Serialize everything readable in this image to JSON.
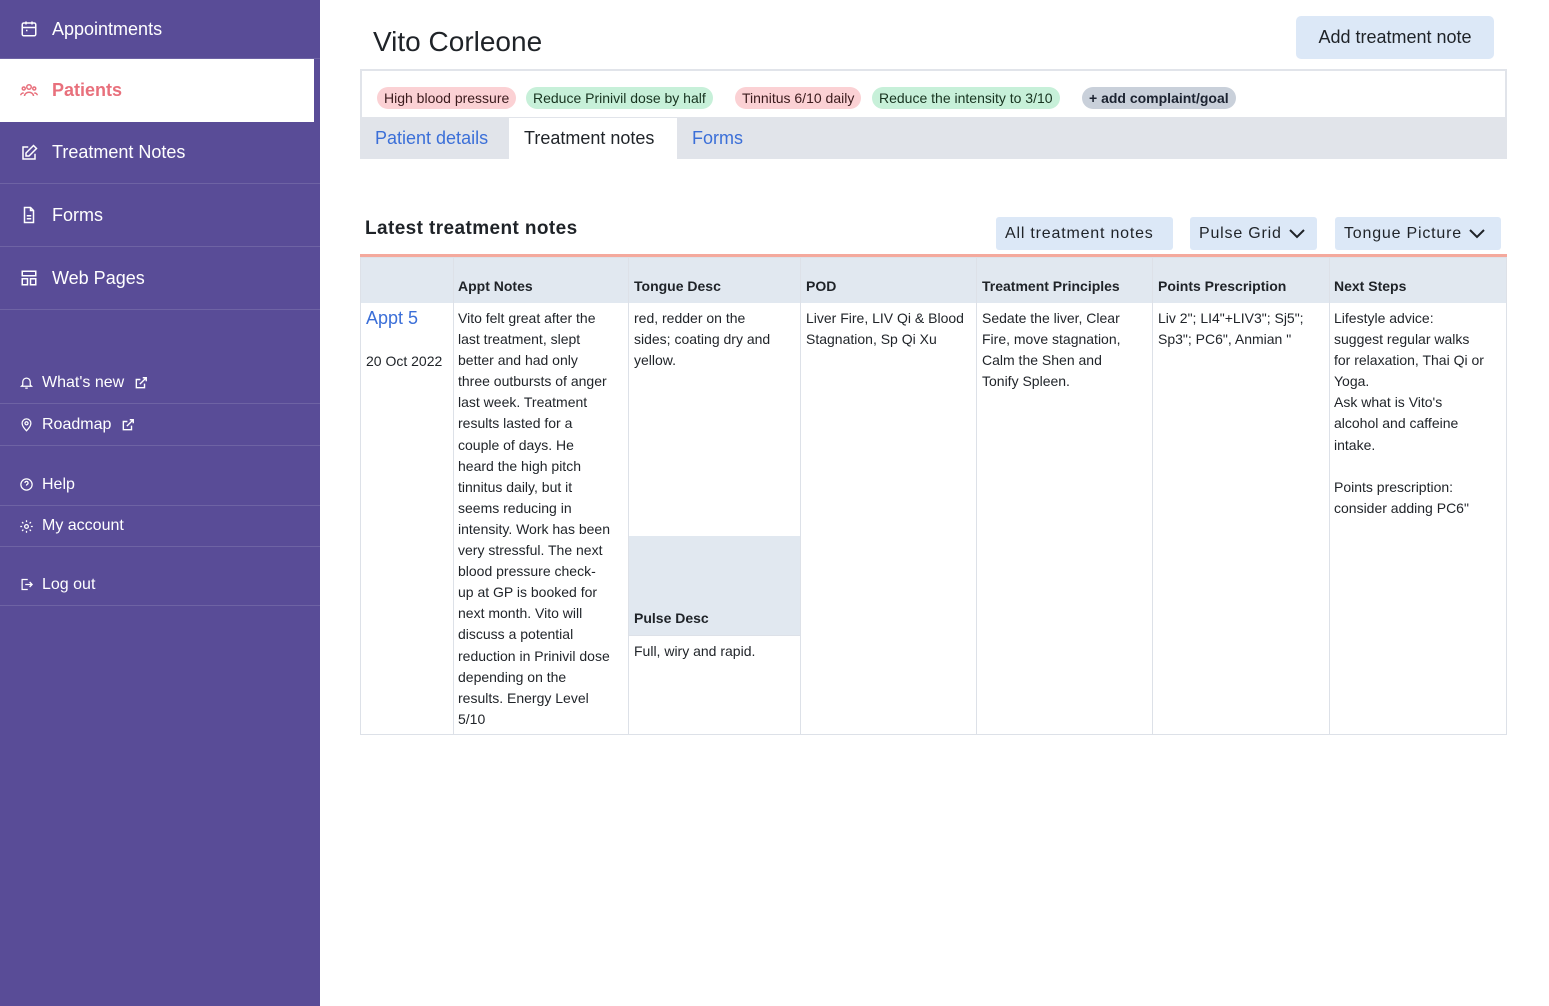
{
  "sidebar": {
    "items": [
      {
        "label": "Appointments",
        "icon": "calendar-icon"
      },
      {
        "label": "Patients",
        "icon": "users-icon"
      },
      {
        "label": "Treatment Notes",
        "icon": "edit-icon"
      },
      {
        "label": "Forms",
        "icon": "document-icon"
      },
      {
        "label": "Web Pages",
        "icon": "layout-icon"
      }
    ],
    "secondary": [
      {
        "label": "What's new",
        "icon": "bell-icon"
      },
      {
        "label": "Roadmap",
        "icon": "map-pin-icon"
      },
      {
        "label": "Help",
        "icon": "help-circle-icon"
      },
      {
        "label": "My account",
        "icon": "gear-icon"
      },
      {
        "label": "Log out",
        "icon": "logout-icon"
      }
    ],
    "colors": {
      "background": "#594c97",
      "active_text": "#e8707c"
    }
  },
  "header": {
    "patient_name": "Vito Corleone",
    "add_note_label": "Add treatment note"
  },
  "goals": {
    "pills": [
      {
        "label": "High blood pressure",
        "kind": "complaint"
      },
      {
        "label": "Reduce Prinivil dose by half",
        "kind": "goal"
      },
      {
        "label": "Tinnitus 6/10 daily",
        "kind": "complaint"
      },
      {
        "label": "Reduce the intensity to 3/10",
        "kind": "goal"
      }
    ],
    "add_label": "+ add complaint/goal"
  },
  "tabs": [
    {
      "label": "Patient details"
    },
    {
      "label": "Treatment notes",
      "active": true
    },
    {
      "label": "Forms"
    }
  ],
  "section": {
    "title": "Latest treatment notes",
    "filters": [
      {
        "label": "All treatment notes",
        "dropdown": false
      },
      {
        "label": "Pulse Grid",
        "dropdown": true
      },
      {
        "label": "Tongue Picture",
        "dropdown": true
      }
    ]
  },
  "table": {
    "columns": [
      "Appt Notes",
      "Tongue Desc",
      "POD",
      "Treatment Principles",
      "Points Prescription",
      "Next Steps"
    ],
    "pulse_header": "Pulse Desc",
    "rows": [
      {
        "appt": "Appt 5",
        "date": "20 Oct 2022",
        "appt_notes": "Vito felt great after the\nlast treatment, slept\nbetter and had only\nthree outbursts of anger\nlast week. Treatment\nresults lasted for a\ncouple of days. He\nheard the high pitch\ntinnitus daily, but it\nseems reducing in\nintensity. Work has been\nvery stressful. The next\nblood pressure check-\nup at GP is booked for\nnext month. Vito will\ndiscuss a potential\nreduction in Prinivil dose\ndepending on the\nresults. Energy Level\n5/10",
        "tongue_desc": "red, redder on the\nsides; coating dry and\nyellow.",
        "pulse_desc": "Full, wiry and rapid.",
        "pod": "Liver Fire, LIV Qi & Blood\nStagnation, Sp Qi Xu",
        "treatment_principles": "Sedate the liver, Clear\nFire, move stagnation,\nCalm the Shen and\nTonify Spleen.",
        "points_prescription": "Liv 2\"; LI4\"+LIV3\"; Sj5\";\nSp3\"; PC6\", Anmian \"",
        "next_steps": "Lifestyle advice:\nsuggest regular walks\nfor relaxation, Thai Qi or\nYoga.\nAsk what is Vito's\nalcohol and caffeine\nintake.\n\nPoints prescription:\nconsider adding PC6\""
      }
    ]
  }
}
